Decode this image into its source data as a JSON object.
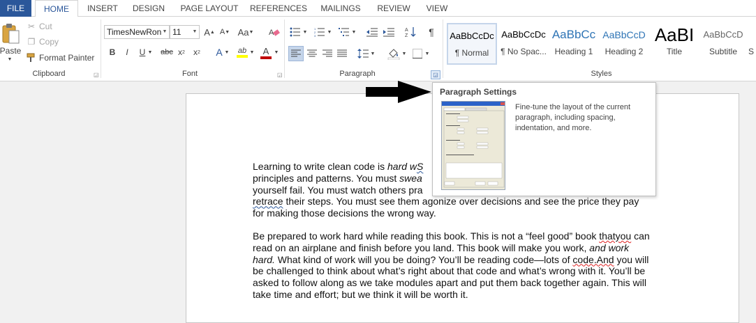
{
  "tabs": [
    {
      "label": "FILE"
    },
    {
      "label": "HOME"
    },
    {
      "label": "INSERT"
    },
    {
      "label": "DESIGN"
    },
    {
      "label": "PAGE LAYOUT"
    },
    {
      "label": "REFERENCES"
    },
    {
      "label": "MAILINGS"
    },
    {
      "label": "REVIEW"
    },
    {
      "label": "VIEW"
    }
  ],
  "clipboard": {
    "paste": "Paste",
    "cut": "Cut",
    "copy": "Copy",
    "format_painter": "Format Painter",
    "group_label": "Clipboard"
  },
  "font": {
    "name": "TimesNewRon",
    "size": "11",
    "group_label": "Font",
    "grow": "A",
    "shrink": "A",
    "case": "Aa",
    "bold": "B",
    "italic": "I",
    "underline": "U",
    "strike": "abc",
    "subscript": "x",
    "superscript": "x",
    "effects": "A",
    "highlight": "ab",
    "color": "A"
  },
  "paragraph": {
    "group_label": "Paragraph",
    "pilcrow": "¶"
  },
  "styles": {
    "group_label": "Styles",
    "items": [
      {
        "sample": "AaBbCcDc",
        "name": "¶ Normal"
      },
      {
        "sample": "AaBbCcDc",
        "name": "¶ No Spac..."
      },
      {
        "sample": "AaBbCc",
        "name": "Heading 1"
      },
      {
        "sample": "AaBbCcD",
        "name": "Heading 2"
      },
      {
        "sample": "AaBI",
        "name": "Title"
      },
      {
        "sample": "AaBbCcD",
        "name": "Subtitle"
      },
      {
        "sample": "",
        "name": "S"
      }
    ]
  },
  "tooltip": {
    "title": "Paragraph Settings",
    "description": "Fine-tune the layout of the current paragraph, including spacing, indentation, and more."
  },
  "document": {
    "p1": {
      "l1a": "Learning to write clean code is ",
      "l1b": "hard w",
      "l1c": "S",
      "l2a": "principles and patterns. You must ",
      "l2b": "swea",
      "l3": "yourself fail. You must watch others pra",
      "l4a": "retrace",
      "l4b": " their steps. You must see them agonize over decisions and see the price they pay",
      "l5": "for making those decisions the wrong way."
    },
    "p2": {
      "l1a": "Be prepared to work hard while reading this book. This is not a “feel good” book ",
      "l1b": "thatyou",
      "l1c": " can",
      "l2a": "read on an airplane and finish before you land. This book will make you work, ",
      "l2b": "and work",
      "l3a": "hard.",
      "l3b": " What kind of work will you be doing? You’ll be reading code—lots of ",
      "l3c": "code.And",
      "l3d": " you will",
      "l4": "be challenged to think about what’s right about that code and what’s wrong with it. You’ll be",
      "l5": "asked to follow along as we take modules apart and put them back together again. This will",
      "l6": "take time and effort; but we think it will be worth it."
    }
  },
  "colors": {
    "file_tab": "#2b579a",
    "accent": "#2b579a",
    "highlight": "#ffff00",
    "font_color": "#c00000"
  }
}
